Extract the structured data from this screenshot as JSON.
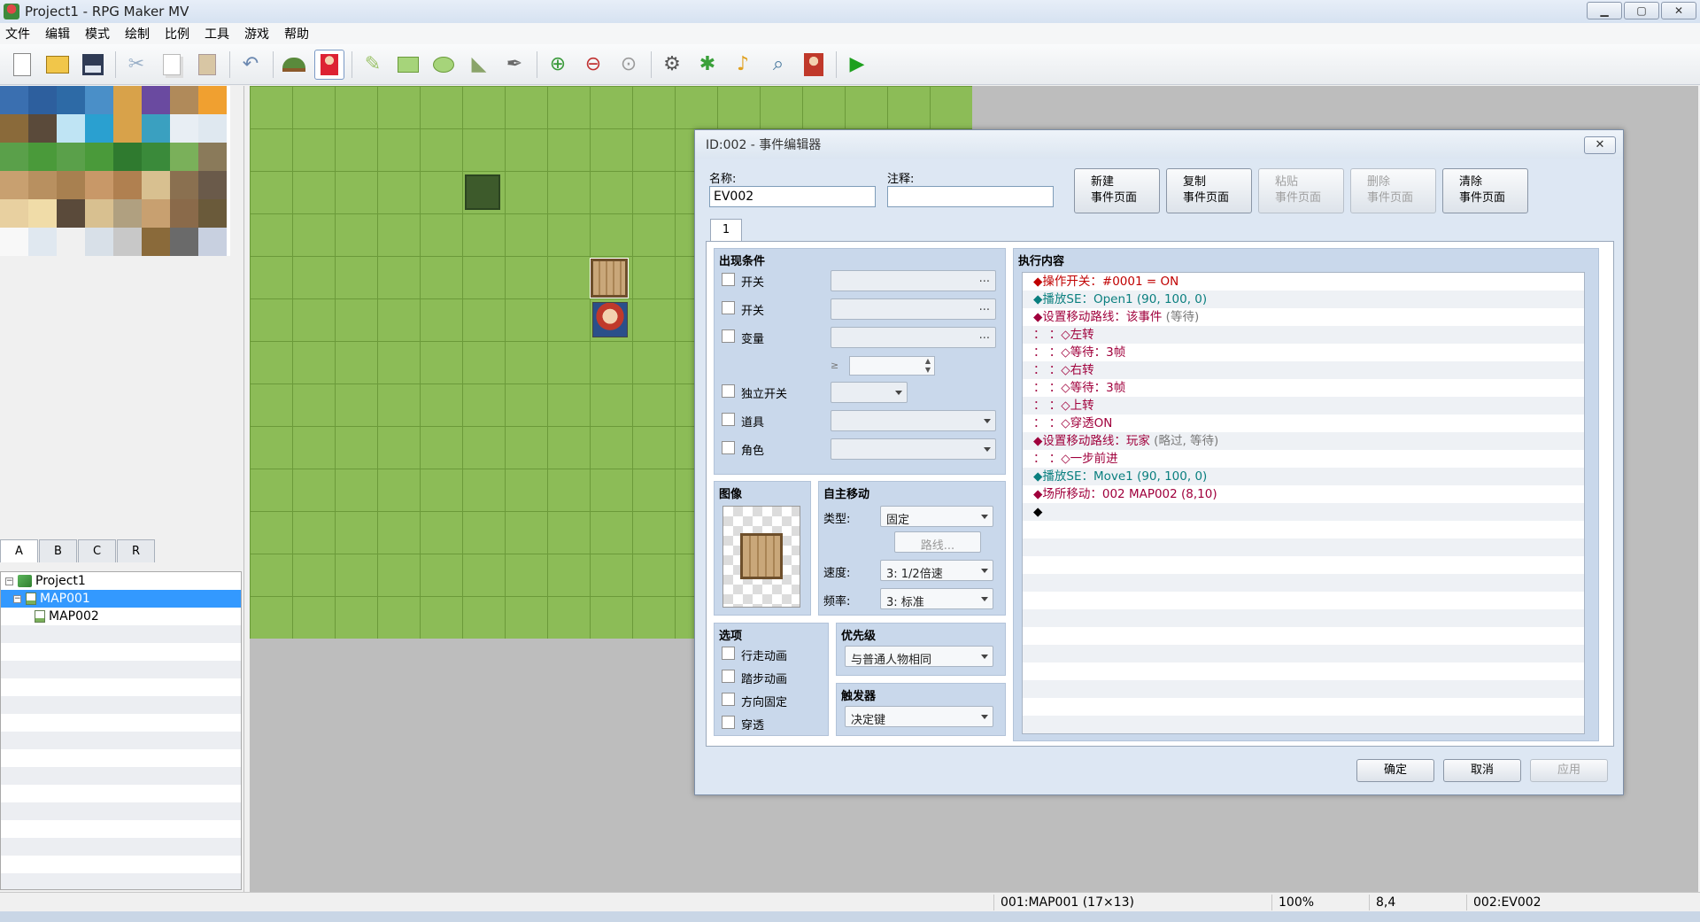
{
  "window": {
    "title": "Project1 - RPG Maker MV",
    "minimize": "▁",
    "maximize": "▢",
    "close": "✕"
  },
  "menu": [
    "文件",
    "编辑",
    "模式",
    "绘制",
    "比例",
    "工具",
    "游戏",
    "帮助"
  ],
  "toolbar": [
    "new-project",
    "open-project",
    "save-project",
    "cut",
    "copy",
    "paste",
    "undo",
    "map-mode",
    "event-mode",
    "pencil",
    "rectangle",
    "ellipse",
    "flood-fill",
    "shadow-pen",
    "zoom-in",
    "zoom-out",
    "zoom-actual",
    "database",
    "plugin-manager",
    "sound-test",
    "event-searcher",
    "character-generator",
    "playtest"
  ],
  "tileset_tabs": [
    "A",
    "B",
    "C",
    "R"
  ],
  "map_tree": {
    "project": "Project1",
    "maps": [
      {
        "name": "MAP001",
        "selected": true
      },
      {
        "name": "MAP002",
        "selected": false
      }
    ]
  },
  "status": {
    "map": "001:MAP001 (17×13)",
    "zoom": "100%",
    "coords": "8,4",
    "event": "002:EV002"
  },
  "dialog": {
    "title": "ID:002 - 事件编辑器",
    "close_label": "✕",
    "name_label": "名称:",
    "name_value": "EV002",
    "note_label": "注释:",
    "note_value": "",
    "page_buttons": [
      {
        "l1": "新建",
        "l2": "事件页面",
        "enabled": true
      },
      {
        "l1": "复制",
        "l2": "事件页面",
        "enabled": true
      },
      {
        "l1": "粘贴",
        "l2": "事件页面",
        "enabled": false
      },
      {
        "l1": "删除",
        "l2": "事件页面",
        "enabled": false
      },
      {
        "l1": "清除",
        "l2": "事件页面",
        "enabled": true
      }
    ],
    "page_tab": "1",
    "conditions": {
      "title": "出现条件",
      "switch1": "开关",
      "switch2": "开关",
      "variable": "变量",
      "gte": "≥",
      "self_switch": "独立开关",
      "item": "道具",
      "actor": "角色",
      "dots": "..."
    },
    "image": {
      "title": "图像"
    },
    "autonomous": {
      "title": "自主移动",
      "type_label": "类型:",
      "type_value": "固定",
      "route_button": "路线...",
      "speed_label": "速度:",
      "speed_value": "3: 1/2倍速",
      "freq_label": "频率:",
      "freq_value": "3: 标准"
    },
    "options": {
      "title": "选项",
      "items": [
        "行走动画",
        "踏步动画",
        "方向固定",
        "穿透"
      ]
    },
    "priority": {
      "title": "优先级",
      "value": "与普通人物相同"
    },
    "trigger": {
      "title": "触发器",
      "value": "决定键"
    },
    "contents": {
      "title": "执行内容",
      "commands": [
        {
          "text": "◆操作开关：#0001 = ON",
          "color": "#c00000"
        },
        {
          "text": "◆播放SE：Open1 (90, 100, 0)",
          "color": "#0a7f7f"
        },
        {
          "text": "◆设置移动路线：该事件",
          "tail": " (等待)",
          "color": "#a0003c"
        },
        {
          "text": "：                    ：◇左转",
          "color": "#a0003c"
        },
        {
          "text": "：                    ：◇等待：3帧",
          "color": "#a0003c"
        },
        {
          "text": "：                    ：◇右转",
          "color": "#a0003c"
        },
        {
          "text": "：                    ：◇等待：3帧",
          "color": "#a0003c"
        },
        {
          "text": "：                    ：◇上转",
          "color": "#a0003c"
        },
        {
          "text": "：                    ：◇穿透ON",
          "color": "#a0003c"
        },
        {
          "text": "◆设置移动路线：玩家",
          "tail": " (略过, 等待)",
          "color": "#a0003c"
        },
        {
          "text": "：                    ：◇一步前进",
          "color": "#a0003c"
        },
        {
          "text": "◆播放SE：Move1 (90, 100, 0)",
          "color": "#0a7f7f"
        },
        {
          "text": "◆场所移动：002 MAP002 (8,10)",
          "color": "#a0003c"
        },
        {
          "text": "◆",
          "color": "#000000"
        }
      ]
    },
    "ok": "确定",
    "cancel": "取消",
    "apply": "应用"
  }
}
